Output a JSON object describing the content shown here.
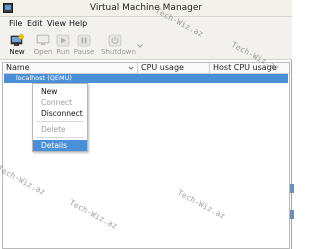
{
  "window": {
    "title": "Virtual Machine Manager"
  },
  "menubar": {
    "items": [
      "File",
      "Edit",
      "View",
      "Help"
    ]
  },
  "toolbar": {
    "buttons": [
      {
        "label": "New",
        "icon": "new-vm-icon",
        "enabled": true
      },
      {
        "label": "Open",
        "icon": "monitor-icon",
        "enabled": false
      },
      {
        "label": "Run",
        "icon": "play-icon",
        "enabled": false
      },
      {
        "label": "Pause",
        "icon": "pause-icon",
        "enabled": false
      },
      {
        "label": "Shutdown",
        "icon": "power-icon",
        "enabled": false
      }
    ]
  },
  "list": {
    "columns": [
      "Name",
      "CPU usage",
      "Host CPU usage"
    ],
    "rows": [
      {
        "name": "localhost (QEMU)",
        "selected": true
      }
    ]
  },
  "context_menu": {
    "items": [
      {
        "label": "New",
        "enabled": true,
        "highlighted": false
      },
      {
        "label": "Connect",
        "enabled": false,
        "highlighted": false
      },
      {
        "label": "Disconnect",
        "enabled": true,
        "highlighted": false
      },
      {
        "label": "Delete",
        "enabled": false,
        "highlighted": false
      },
      {
        "label": "Details",
        "enabled": true,
        "highlighted": true
      }
    ]
  },
  "watermark": {
    "text": "Tech-Wiz.az"
  },
  "colors": {
    "selection": "#4a90d9",
    "titlebar": "#f3f2ea",
    "menubar": "#f2f1ee"
  }
}
